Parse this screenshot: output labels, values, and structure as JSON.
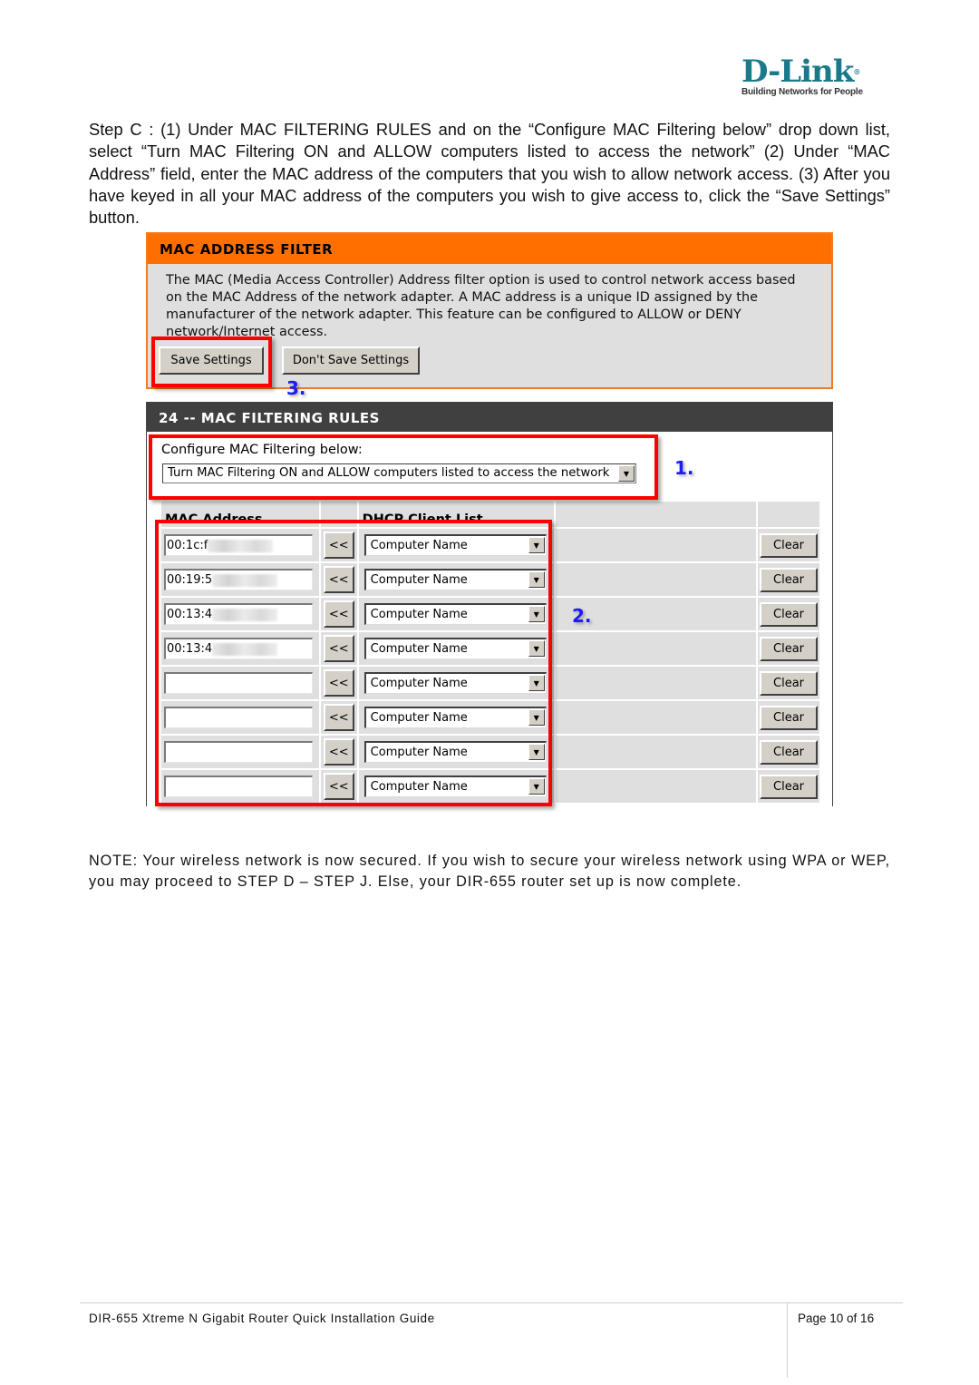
{
  "logo": {
    "word": "D-Link",
    "registered": "®",
    "tagline": "Building Networks for People"
  },
  "intro": "Step C :  (1) Under MAC FILTERING RULES and on the “Configure MAC Filtering below” drop down list, select “Turn MAC Filtering ON and ALLOW computers listed to access the network”  (2) Under “MAC Address” field, enter the MAC address of the computers that you wish to allow network access.  (3) After you have keyed in all your MAC address of the computers you wish to give access to, click the “Save Settings” button.",
  "mac_filter": {
    "title": "MAC ADDRESS FILTER",
    "description": "The MAC (Media Access Controller) Address filter option is used to control network access based on the MAC Address of the network adapter. A MAC address is a unique ID assigned by the manufacturer of the network adapter. This feature can be configured to ALLOW or DENY network/Internet access.",
    "save_label": "Save Settings",
    "dont_save_label": "Don't Save Settings"
  },
  "rules": {
    "title": "24 -- MAC FILTERING RULES",
    "configure_label": "Configure MAC Filtering below:",
    "configure_value": "Turn MAC Filtering ON and ALLOW computers listed to access the network",
    "col_mac": "MAC Address",
    "col_dhcp": "DHCP Client List",
    "copy_label": "<<",
    "clear_label": "Clear",
    "rows": [
      {
        "mac": "00:1c:f",
        "blurred": true,
        "dhcp": "Computer Name"
      },
      {
        "mac": "00:19:5",
        "blurred": true,
        "dhcp": "Computer Name"
      },
      {
        "mac": "00:13:4",
        "blurred": true,
        "dhcp": "Computer Name"
      },
      {
        "mac": "00:13:4",
        "blurred": true,
        "dhcp": "Computer Name"
      },
      {
        "mac": "",
        "blurred": false,
        "dhcp": "Computer Name"
      },
      {
        "mac": "",
        "blurred": false,
        "dhcp": "Computer Name"
      },
      {
        "mac": "",
        "blurred": false,
        "dhcp": "Computer Name"
      },
      {
        "mac": "",
        "blurred": false,
        "dhcp": "Computer Name"
      }
    ]
  },
  "annotations": {
    "step1": "1.",
    "step2": "2.",
    "step3": "3."
  },
  "note": "NOTE: Your wireless network is now secured. If you wish to secure your wireless network using WPA or WEP, you may proceed to STEP D – STEP J.  Else, your DIR-655 router set up is now complete.",
  "footer": {
    "title": "DIR-655 Xtreme N Gigabit Router Quick Installation Guide",
    "page": "Page 10 of 16"
  },
  "colors": {
    "filter_header": "#ff6f00",
    "rules_header": "#404040",
    "highlight": "#ff0000",
    "step_number": "#1a1aff",
    "logo": "#1a7a8a"
  }
}
